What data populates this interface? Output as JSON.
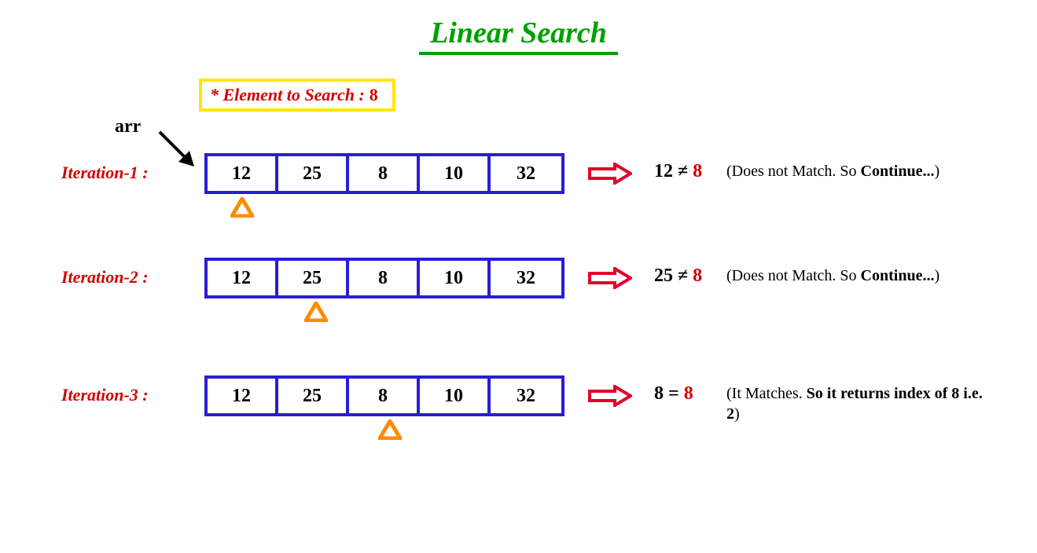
{
  "title": "Linear Search",
  "search_label": "* Element to Search :",
  "search_value": "8",
  "arr_label": "arr",
  "array_values": [
    "12",
    "25",
    "8",
    "10",
    "32"
  ],
  "iterations": [
    {
      "label": "Iteration-1 :",
      "pointer_index": 0,
      "compare_left": "12",
      "compare_op": "≠",
      "compare_right": "8",
      "note_plain": "(Does not Match. So ",
      "note_bold": "Continue...",
      "note_close": ")"
    },
    {
      "label": "Iteration-2 :",
      "pointer_index": 1,
      "compare_left": "25",
      "compare_op": "≠",
      "compare_right": "8",
      "note_plain": "(Does not Match. So ",
      "note_bold": "Continue...",
      "note_close": ")"
    },
    {
      "label": "Iteration-3 :",
      "pointer_index": 2,
      "compare_left": "8",
      "compare_op": "=",
      "compare_right": "8",
      "note_plain": "(It Matches. ",
      "note_bold": "So it returns index of  8 i.e. 2",
      "note_close": ")"
    }
  ]
}
